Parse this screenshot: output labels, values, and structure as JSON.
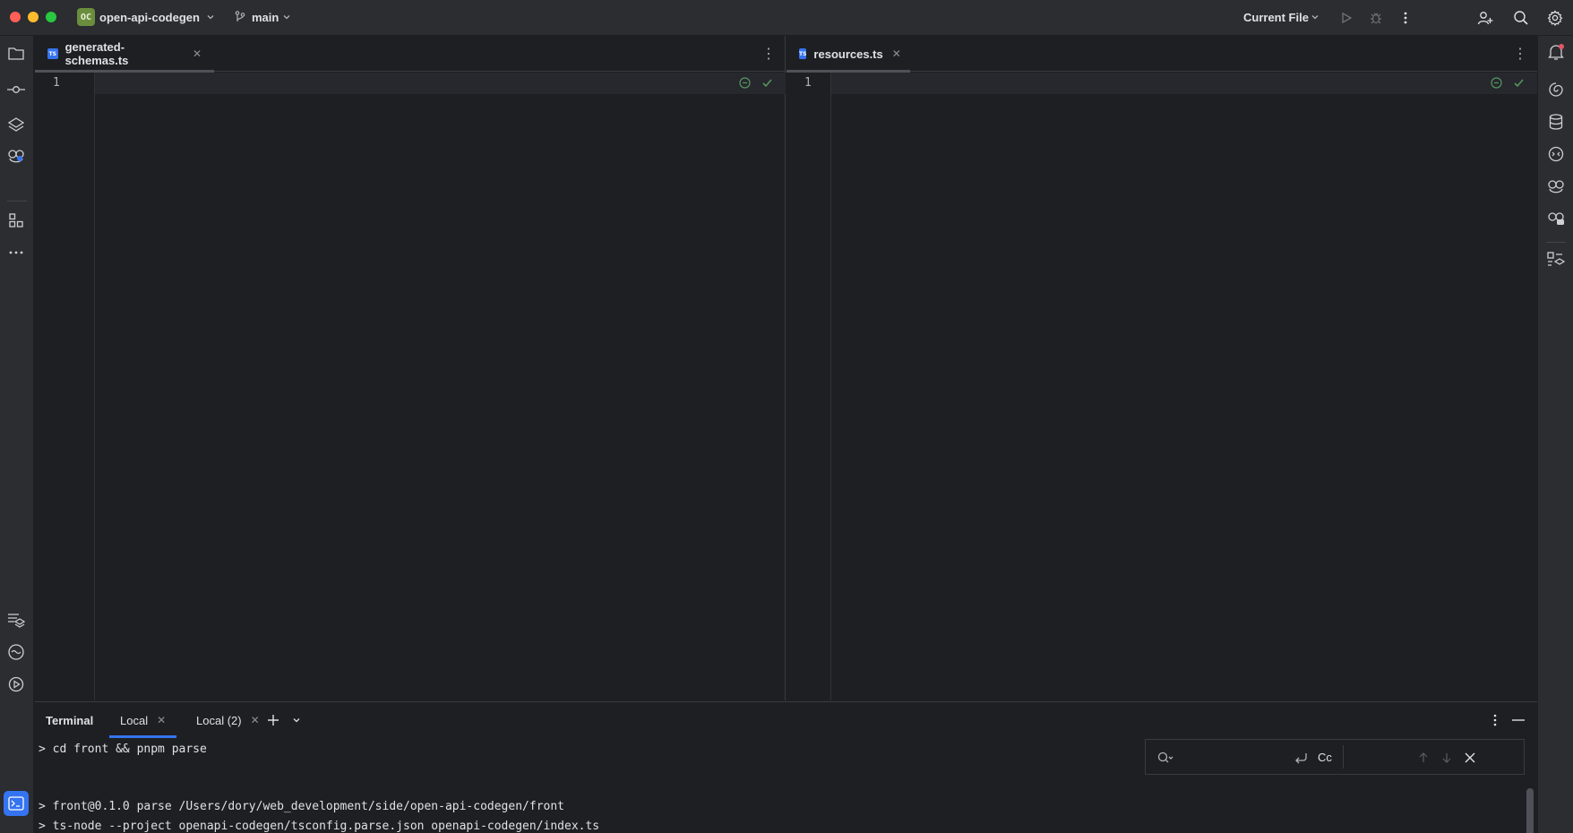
{
  "titlebar": {
    "project_badge": "OC",
    "project_name": "open-api-codegen",
    "branch": "main",
    "run_config": "Current File"
  },
  "editor": {
    "left": {
      "tab_label": "generated-schemas.ts",
      "file_badge": "TS",
      "line_number": "1"
    },
    "right": {
      "tab_label": "resources.ts",
      "file_badge": "TS",
      "line_number": "1"
    }
  },
  "terminal": {
    "title": "Terminal",
    "tabs": [
      {
        "label": "Local",
        "active": true
      },
      {
        "label": "Local (2)",
        "active": false
      }
    ],
    "lines": [
      "> cd front && pnpm parse",
      "> front@0.1.0 parse /Users/dory/web_development/side/open-api-codegen/front",
      "> ts-node --project openapi-codegen/tsconfig.parse.json openapi-codegen/index.ts"
    ],
    "search": {
      "regex_label": "Cc"
    }
  },
  "colors": {
    "accent": "#3574f0",
    "panel": "#2b2d30",
    "editor_bg": "#1e1f22",
    "ok_green": "#57965c"
  }
}
